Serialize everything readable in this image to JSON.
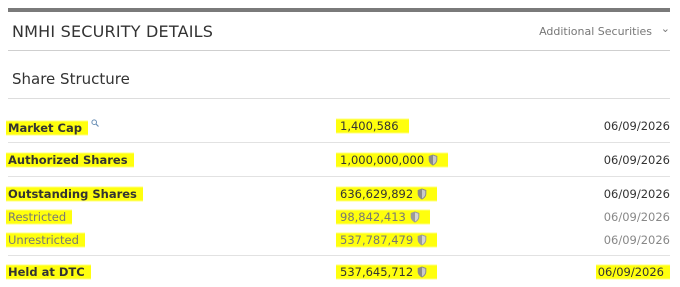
{
  "header": {
    "title": "NMHI SECURITY DETAILS",
    "additional_label": "Additional Securities",
    "chevron_icon": "chevron-down-icon"
  },
  "section": {
    "title": "Share Structure"
  },
  "rows": [
    {
      "label": "Market Cap",
      "value": "1,400,586",
      "date": "06/09/2026",
      "label_icon": "magnifier-icon",
      "value_icon": ""
    },
    {
      "label": "Authorized Shares",
      "value": "1,000,000,000",
      "date": "06/09/2026",
      "label_icon": "",
      "value_icon": "shield-icon"
    },
    {
      "label": "Outstanding Shares",
      "value": "636,629,892",
      "date": "06/09/2026",
      "label_icon": "",
      "value_icon": "shield-icon"
    },
    {
      "label": "Restricted",
      "value": "98,842,413",
      "date": "06/09/2026",
      "label_icon": "",
      "value_icon": "shield-icon"
    },
    {
      "label": "Unrestricted",
      "value": "537,787,479",
      "date": "06/09/2026",
      "label_icon": "",
      "value_icon": "shield-icon"
    },
    {
      "label": "Held at DTC",
      "value": "537,645,712",
      "date": "06/09/2026",
      "label_icon": "",
      "value_icon": "shield-icon"
    }
  ],
  "colors": {
    "highlight": "#ffff00",
    "text": "#333333",
    "muted": "#777777",
    "topbar": "#7a7a7a"
  }
}
